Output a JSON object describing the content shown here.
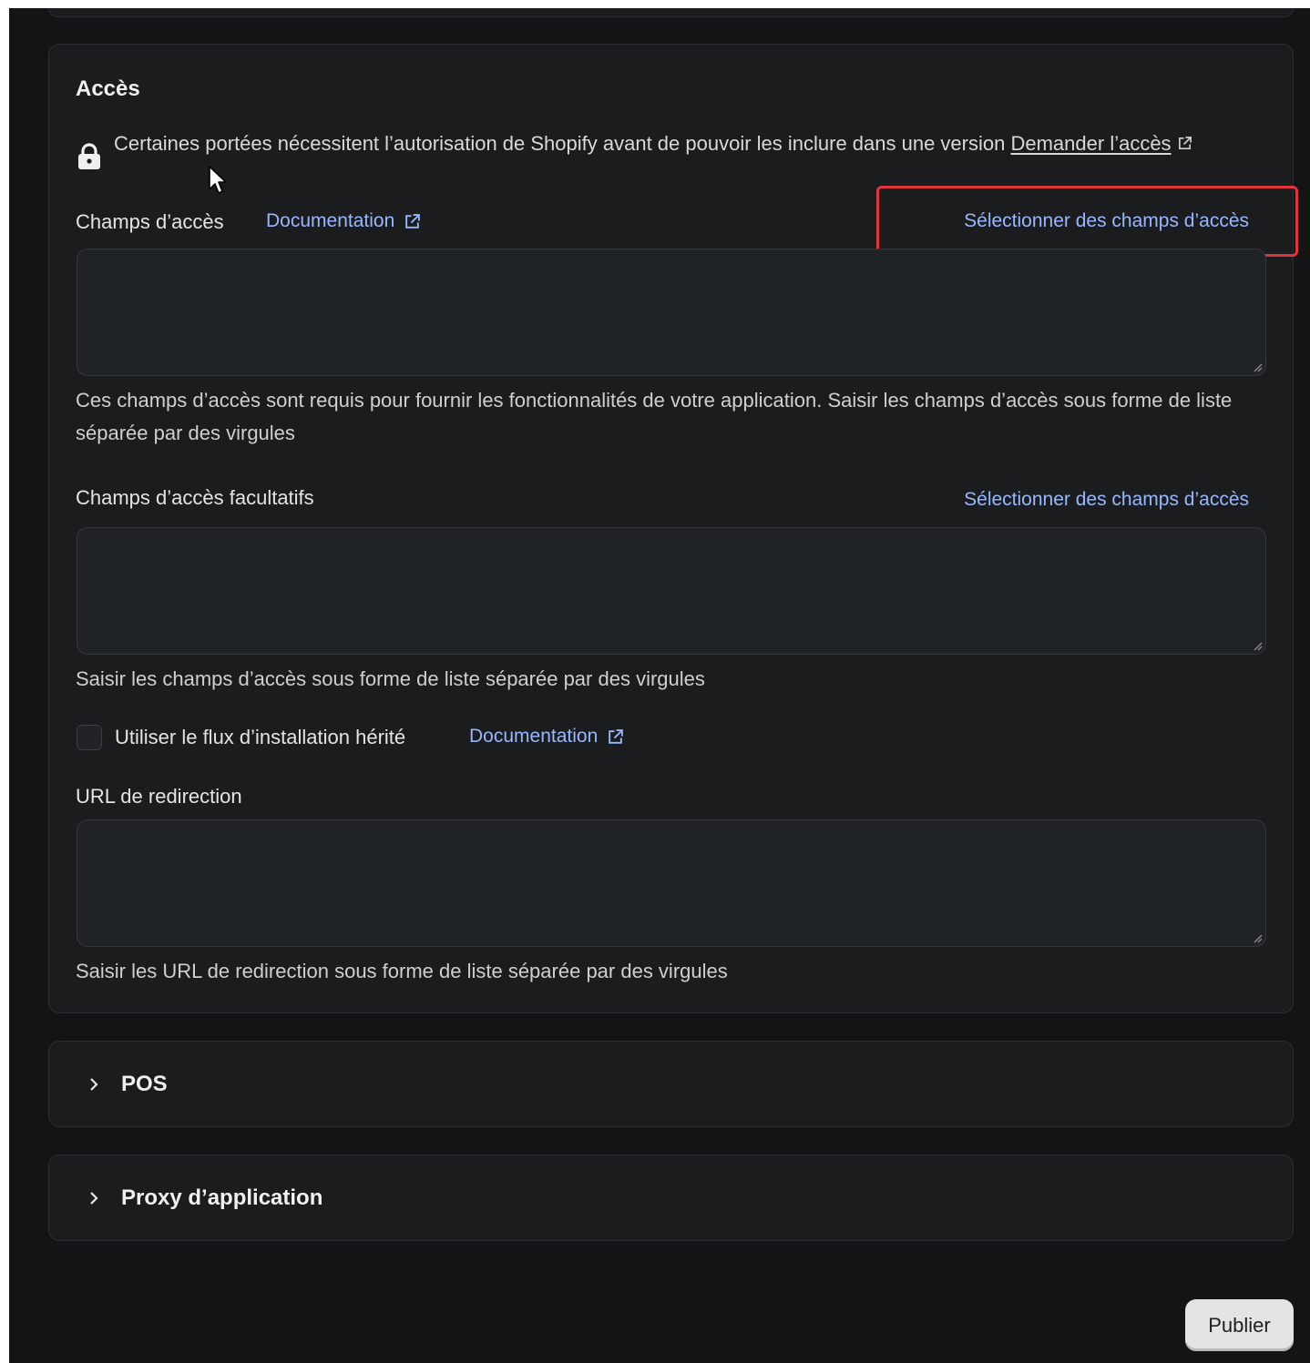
{
  "access": {
    "title": "Accès",
    "notice_text": "Certaines portées nécessitent l’autorisation de Shopify avant de pouvoir les inclure dans une version",
    "notice_link": "Demander l’accès",
    "scopes": {
      "label": "Champs d’accès",
      "doc_link": "Documentation",
      "select_link": "Sélectionner des champs d’accès",
      "value": "",
      "help": "Ces champs d’accès sont requis pour fournir les fonctionnalités de votre application. Saisir les champs d’accès sous forme de liste séparée par des virgules"
    },
    "optional_scopes": {
      "label": "Champs d’accès facultatifs",
      "select_link": "Sélectionner des champs d’accès",
      "value": "",
      "help": "Saisir les champs d’accès sous forme de liste séparée par des virgules"
    },
    "legacy_install": {
      "label": "Utiliser le flux d’installation hérité",
      "doc_link": "Documentation",
      "checked": false
    },
    "redirect": {
      "label": "URL de redirection",
      "value": "",
      "help": "Saisir les URL de redirection sous forme de liste séparée par des virgules"
    }
  },
  "sections": {
    "pos": {
      "title": "POS",
      "expanded": false
    },
    "proxy": {
      "title": "Proxy d’application",
      "expanded": false
    }
  },
  "footer": {
    "publish_label": "Publier"
  },
  "colors": {
    "link": "#97b8ff",
    "highlight": "#e0353b",
    "background": "#131415",
    "card": "#1b1c1e"
  }
}
